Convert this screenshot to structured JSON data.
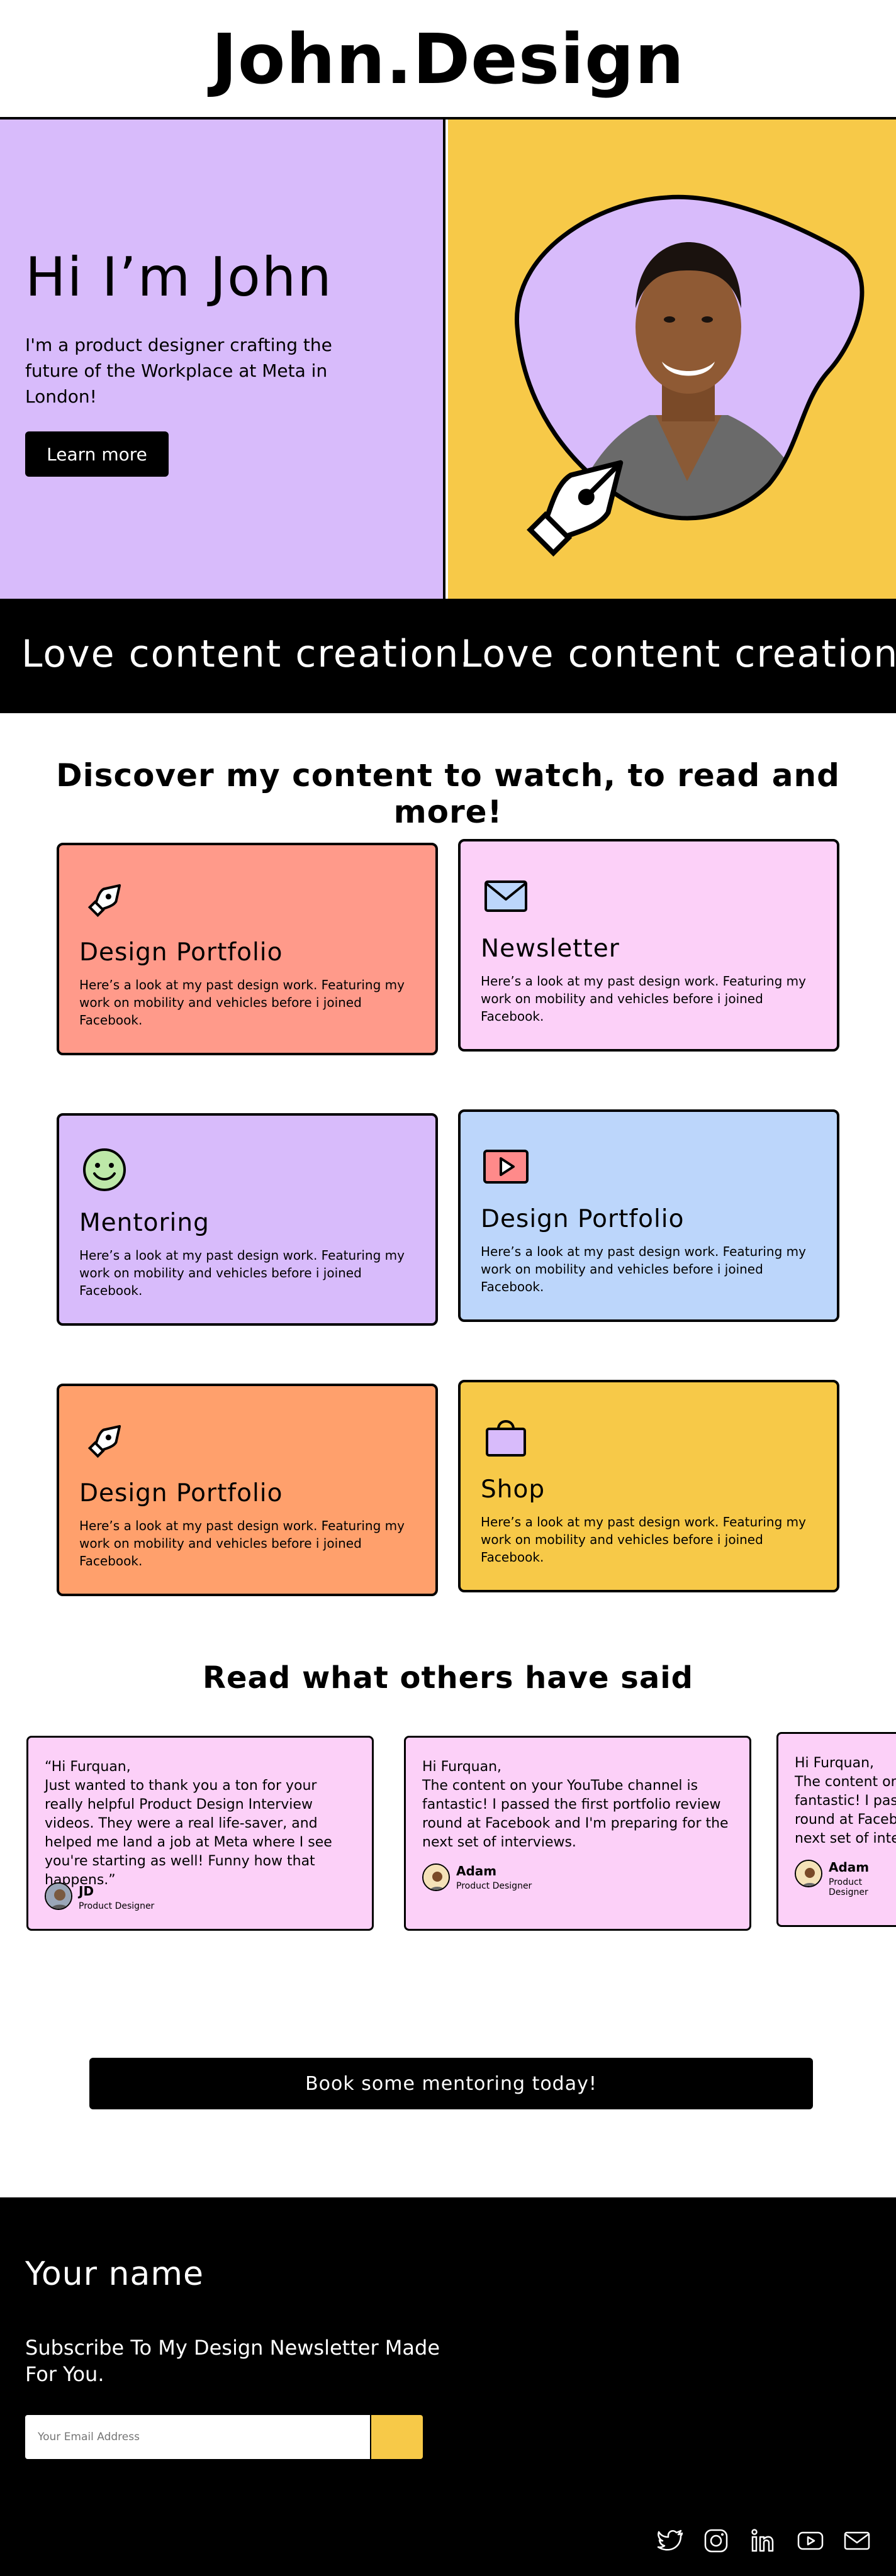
{
  "header": {
    "logo": "John.Design"
  },
  "hero": {
    "title": "Hi I’m John",
    "text": "I'm a product designer crafting the future of the Workplace at Meta in London!",
    "button_label": "Learn more"
  },
  "marquee": {
    "text": "Love content creation."
  },
  "discover": {
    "title": "Discover my content to watch, to read and more!",
    "cards": [
      {
        "title": "Design Portfolio",
        "text": "Here’s a look at my past design work. Featuring my work on mobility and vehicles before i joined Facebook.",
        "icon": "pen-nib-icon",
        "color": "#ff9a8a"
      },
      {
        "title": "Newsletter",
        "text": "Here’s a look at my past design work. Featuring my work on mobility and vehicles before i joined Facebook.",
        "icon": "envelope-icon",
        "color": "#fcd0f8"
      },
      {
        "title": "Mentoring",
        "text": "Here’s a look at my past design work. Featuring my work on mobility and vehicles before i joined Facebook.",
        "icon": "smiley-icon",
        "color": "#d8bbfb"
      },
      {
        "title": "Design Portfolio",
        "text": "Here’s a look at my past design work. Featuring my work on mobility and vehicles before i joined Facebook.",
        "icon": "video-play-icon",
        "color": "#bcd6fb"
      },
      {
        "title": "Design Portfolio",
        "text": "Here’s a look at my past design work. Featuring my work on mobility and vehicles before i joined Facebook.",
        "icon": "pen-nib-icon",
        "color": "#ffa06c"
      },
      {
        "title": "Shop",
        "text": "Here’s a look at my past design work. Featuring my work on mobility and vehicles before i joined Facebook.",
        "icon": "shopping-bag-icon",
        "color": "#f7c948"
      }
    ]
  },
  "testimonials": {
    "title": "Read what others have said",
    "items": [
      {
        "text": "“Hi Furquan,\nJust wanted to thank you a ton for your really helpful Product Design Interview videos. They were a real life-saver, and helped me land a job at Meta where I see you're starting as well! Funny how that happens.”",
        "name": "JD",
        "role": "Product Designer"
      },
      {
        "text": "Hi Furquan,\nThe content on your YouTube channel is fantastic! I passed the first portfolio review round at Facebook and I'm preparing for the next set of interviews.",
        "name": "Adam",
        "role": "Product Designer"
      },
      {
        "text": "Hi Furquan,\nThe content on your YouTube channel is fantastic! I passed the first portfolio review round at Facebook and I'm preparing for the next set of interviews.",
        "name": "Adam",
        "role": "Product Designer"
      }
    ]
  },
  "cta": {
    "label": "Book some mentoring today!"
  },
  "footer": {
    "name": "Your name",
    "subscribe_text": "Subscribe To My Design Newsletter Made For You.",
    "email_placeholder": "Your Email Address",
    "social_icons": [
      "twitter-icon",
      "instagram-icon",
      "linkedin-icon",
      "youtube-icon",
      "mail-icon"
    ]
  },
  "colors": {
    "lilac": "#d8bbfb",
    "yellow": "#f7c948",
    "pink": "#fcd0f8",
    "salmon": "#ff9a8a",
    "blue": "#bcd6fb",
    "orange": "#ffa06c"
  }
}
